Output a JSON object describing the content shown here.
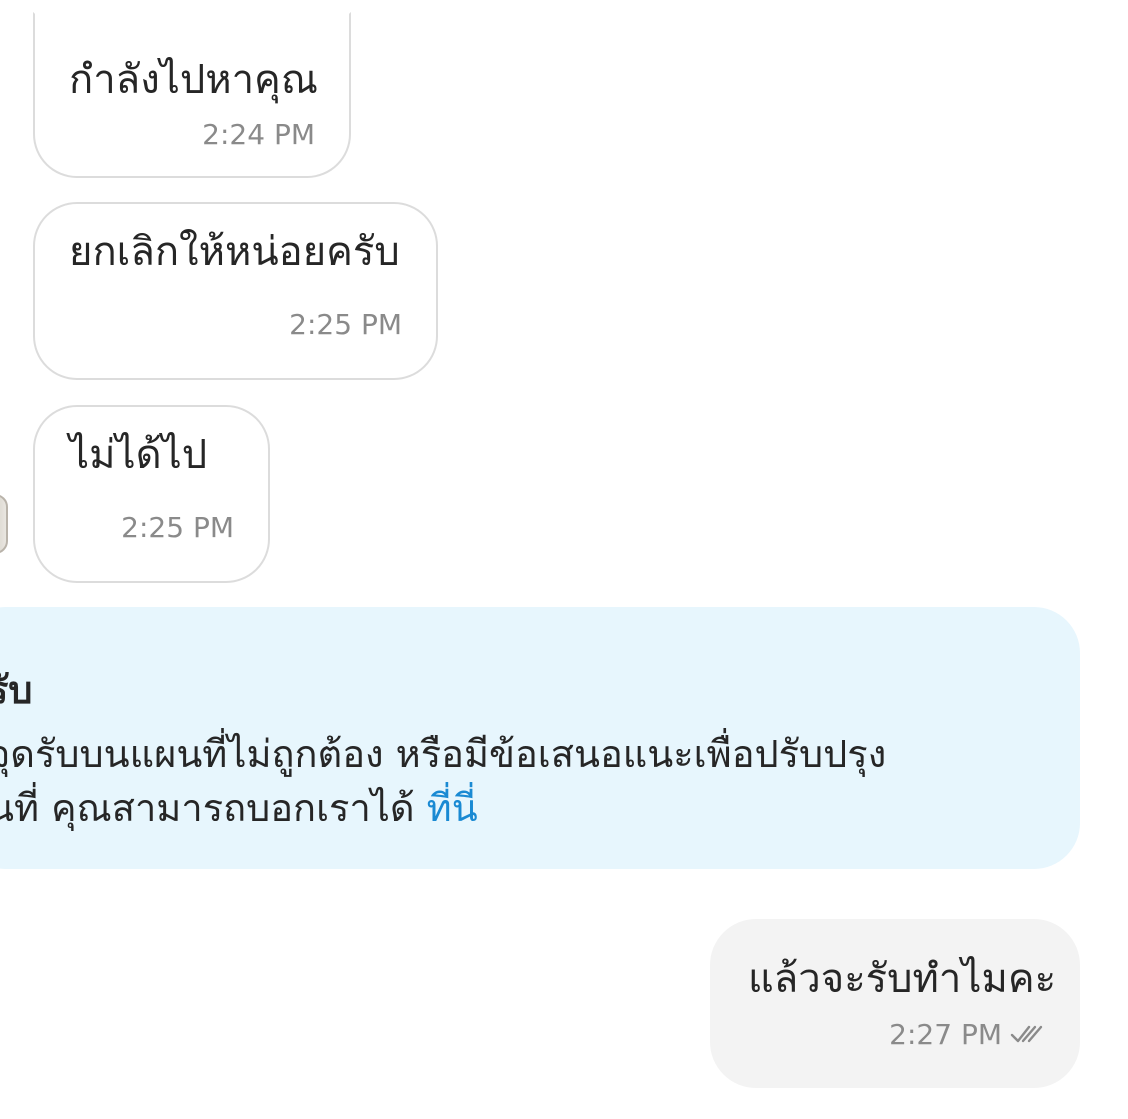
{
  "messages": [
    {
      "text": "กำลังไปหาคุณ",
      "time": "2:24 PM"
    },
    {
      "text": "ยกเลิกให้หน่อยครับ",
      "time": "2:25 PM"
    },
    {
      "text": "ไม่ได้ไป",
      "time": "2:25 PM"
    }
  ],
  "notice": {
    "title": "รับ",
    "line1": "จุดรับบนแผนที่ไม่ถูกต้อง หรือมีข้อเสนอแนะเพื่อปรับปรุง",
    "line2": "นที่ คุณสามารถบอกเราได้ ",
    "link": "ที่นี่"
  },
  "outgoing": {
    "text": "แล้วจะรับทำไมคะ",
    "time": "2:27 PM",
    "status_icon": "double-check-icon"
  },
  "colors": {
    "incoming_border": "#dcdcdc",
    "notice_bg": "#e7f6fd",
    "link": "#1a8ad3",
    "outgoing_bg": "#f3f3f3",
    "timestamp": "#8a8a8a"
  }
}
